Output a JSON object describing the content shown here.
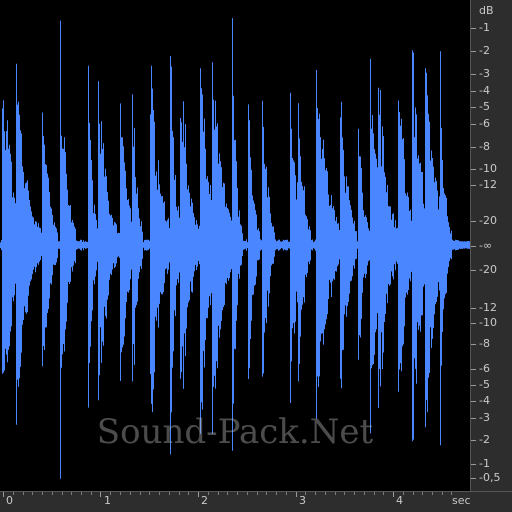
{
  "colors": {
    "waveform": "#4a86ff",
    "background": "#000000",
    "ruler_bg": "#2d2d2d",
    "ruler_text": "#c8c8c8"
  },
  "db_ruler": {
    "unit": "dB",
    "labels_top": [
      "-1",
      "-2",
      "-3",
      "-4",
      "-5",
      "-6",
      "-8",
      "-10",
      "-12",
      "-20"
    ],
    "center_label": "-∞",
    "labels_bottom": [
      "-20",
      "-12",
      "-10",
      "-8",
      "-6",
      "-5",
      "-4",
      "-3",
      "-2",
      "-1",
      "-0,5"
    ]
  },
  "time_ruler": {
    "unit": "sec",
    "labels": [
      "0",
      "1",
      "2",
      "3",
      "4"
    ]
  },
  "watermark": "Sound-Pack.Net"
}
